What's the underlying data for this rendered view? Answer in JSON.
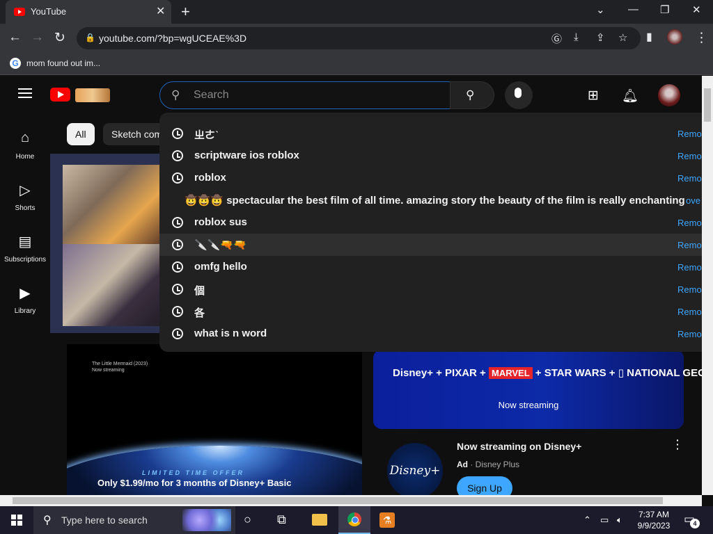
{
  "browser": {
    "tab_title": "YouTube",
    "url": "youtube.com/?bp=wgUCEAE%3D",
    "bookmark": "mom found out im..."
  },
  "header": {
    "search_placeholder": "Search"
  },
  "sidebar": {
    "items": [
      {
        "label": "Home",
        "icon": "home-icon"
      },
      {
        "label": "Shorts",
        "icon": "shorts-icon"
      },
      {
        "label": "Subscriptions",
        "icon": "subscriptions-icon"
      },
      {
        "label": "Library",
        "icon": "library-icon"
      }
    ]
  },
  "chips": [
    "All",
    "Sketch com"
  ],
  "suggestions": [
    {
      "text": "ㄓㄜˋ",
      "remove": "Remo"
    },
    {
      "text": "scriptware ios roblox",
      "remove": "Remo"
    },
    {
      "text": "roblox",
      "remove": "Remo"
    },
    {
      "text": "🤠🤠🤠 spectacular the best film of all time. amazing story the beauty of the film is really enchanting",
      "remove": "ove"
    },
    {
      "text": "roblox sus",
      "remove": "Remo"
    },
    {
      "text": "🔪🔪🔫🔫",
      "remove": "Remo"
    },
    {
      "text": "omfg hello",
      "remove": "Remo"
    },
    {
      "text": "個",
      "remove": "Remo"
    },
    {
      "text": "各",
      "remove": "Remo"
    },
    {
      "text": "what is n word",
      "remove": "Remo"
    }
  ],
  "ad": {
    "video_title": "The Little Mermaid (2023)\nNow streaming",
    "limited_offer": "LIMITED TIME OFFER",
    "offer": "Only $1.99/mo for 3 months of Disney+ Basic",
    "banner_sub": "Now streaming",
    "logo_text": "Disney+",
    "title": "Now streaming on Disney+",
    "ad_label": "Ad",
    "advertiser": "Disney Plus",
    "cta": "Sign Up"
  },
  "taskbar": {
    "search_placeholder": "Type here to search",
    "time": "7:37 AM",
    "date": "9/9/2023",
    "notifications": "4"
  },
  "colors": {
    "accent": "#3ea6ff",
    "brand": "#ff0000"
  }
}
